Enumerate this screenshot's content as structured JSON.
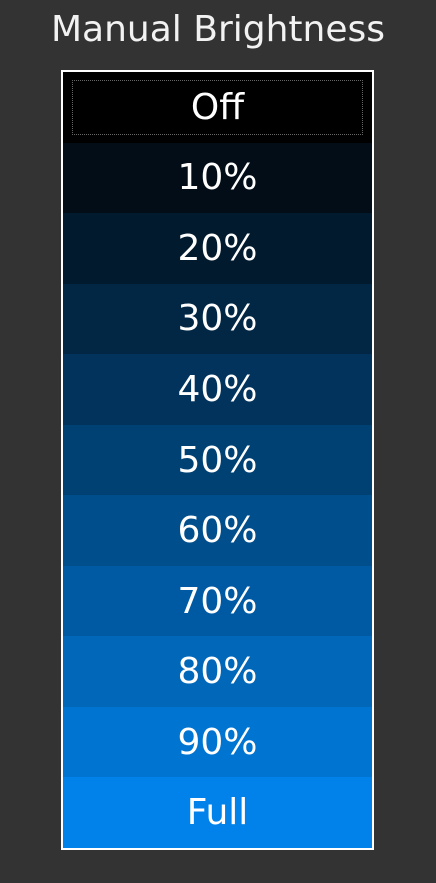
{
  "header": {
    "title": "Manual Brightness"
  },
  "options": [
    {
      "label": "Off",
      "color": "#000000",
      "focused": true
    },
    {
      "label": "10%",
      "color": "#020d17",
      "focused": false
    },
    {
      "label": "20%",
      "color": "#011a2e",
      "focused": false
    },
    {
      "label": "30%",
      "color": "#012745",
      "focused": false
    },
    {
      "label": "40%",
      "color": "#01335c",
      "focused": false
    },
    {
      "label": "50%",
      "color": "#004174",
      "focused": false
    },
    {
      "label": "60%",
      "color": "#004e8b",
      "focused": false
    },
    {
      "label": "70%",
      "color": "#005aa3",
      "focused": false
    },
    {
      "label": "80%",
      "color": "#0067b9",
      "focused": false
    },
    {
      "label": "90%",
      "color": "#0074d1",
      "focused": false
    },
    {
      "label": "Full",
      "color": "#0082ea",
      "focused": false
    }
  ],
  "colors": {
    "background": "#333333",
    "list_border": "#ffffff",
    "text": "#ffffff"
  }
}
